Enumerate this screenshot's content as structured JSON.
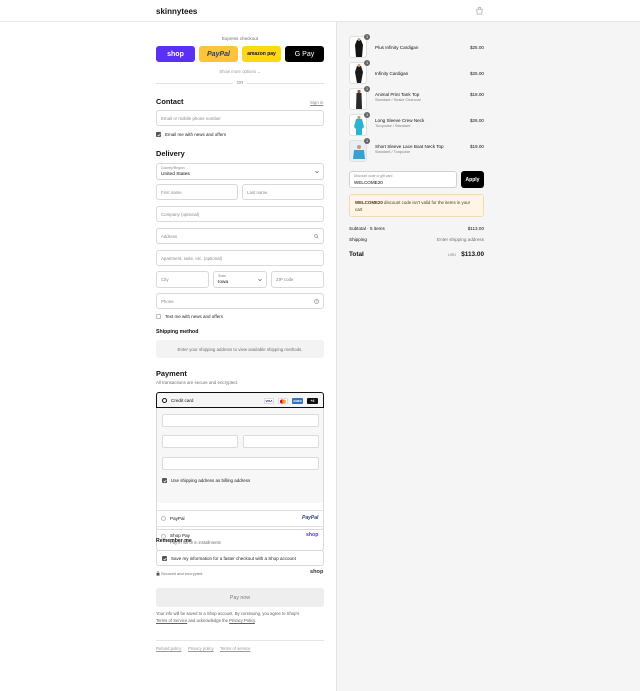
{
  "header": {
    "brand": "skinnytees",
    "bag_icon": "shopping-bag-icon"
  },
  "express": {
    "title": "Express checkout",
    "buttons": {
      "shop": "shop",
      "paypal": "PayPal",
      "amazon": "amazon pay",
      "gpay": "G Pay"
    },
    "show_more": "Show more options ⌄",
    "or": "OR"
  },
  "contact": {
    "title": "Contact",
    "sign_in": "Sign in",
    "email_placeholder": "Email or mobile phone number",
    "news_label": "Email me with news and offers"
  },
  "delivery": {
    "title": "Delivery",
    "country_label": "Country/Region",
    "country_value": "United States",
    "first_name": "First name",
    "last_name": "Last name",
    "company": "Company (optional)",
    "address": "Address",
    "apartment": "Apartment, suite, etc. (optional)",
    "city": "City",
    "state_label": "State",
    "state_value": "Iowa",
    "zip": "ZIP code",
    "phone": "Phone",
    "text_label": "Text me with news and offers"
  },
  "shipping": {
    "title": "Shipping method",
    "notice": "Enter your shipping address to view available shipping methods."
  },
  "payment": {
    "title": "Payment",
    "subtitle": "All transactions are secure and encrypted.",
    "credit_card": "Credit card",
    "cards": [
      "VISA",
      "MC",
      "AMEX",
      "+4"
    ],
    "billing_same": "Use shipping address as billing address",
    "paypal": "PayPal",
    "paypal_logo": "PayPal",
    "shop_pay": "Shop Pay",
    "shop_pay_sub": "Pay in full or in installments",
    "shop_logo": "shop"
  },
  "remember": {
    "title": "Remember me",
    "save_label": "Save my information for a faster checkout with a Shop account",
    "secure": "Secured and encrypted",
    "shop_logo": "shop"
  },
  "pay_now": "Pay now",
  "legal": {
    "line1": "Your info will be saved to a Shop account. By continuing, you agree to Shop's",
    "terms": "Terms of Service",
    "and": "and acknowledge the",
    "privacy": "Privacy Policy"
  },
  "footer": {
    "refund": "Refund policy",
    "privacy": "Privacy policy",
    "terms": "Terms of service"
  },
  "cart": {
    "items": [
      {
        "name": "Plus Infinity Cardigan",
        "variant": "",
        "price": "$25.00",
        "qty": "1"
      },
      {
        "name": "Infinity Cardigan",
        "variant": "",
        "price": "$25.00",
        "qty": "1"
      },
      {
        "name": "Animal Print Tank Top",
        "variant": "Standard / Snake Charcoal",
        "price": "$18.00",
        "qty": "1"
      },
      {
        "name": "Long Sleeve Crew Neck",
        "variant": "Turquoise / Standard",
        "price": "$26.00",
        "qty": "1"
      },
      {
        "name": "Short Sleeve Lace Boat Neck Top",
        "variant": "Standard / Turquoise",
        "price": "$19.00",
        "qty": "1"
      }
    ],
    "discount_label": "Discount code or gift card",
    "discount_value": "WELCOME20",
    "apply": "Apply",
    "warning_code": "WELCOME20",
    "warning_text": "discount code isn't valid for the items in your cart",
    "subtotal_label": "Subtotal · 5 items",
    "subtotal_value": "$113.00",
    "shipping_label": "Shipping",
    "shipping_value": "Enter shipping address",
    "total_label": "Total",
    "currency": "USD",
    "total_value": "$113.00"
  },
  "colors": {
    "shop": "#5a31f4",
    "paypal": "#ffc439",
    "amazon": "#ffd814"
  }
}
